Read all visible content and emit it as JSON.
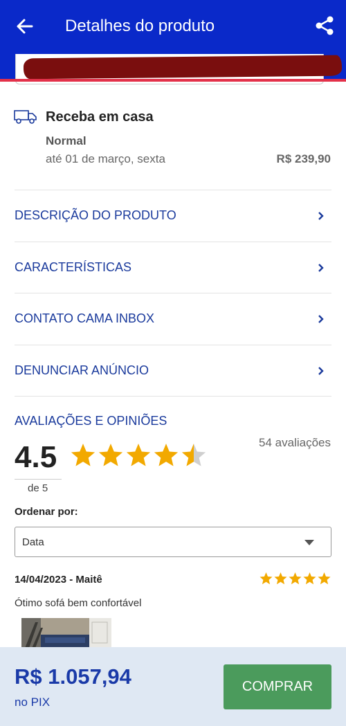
{
  "header": {
    "title": "Detalhes do produto",
    "back_icon": "arrow-left-icon",
    "share_icon": "share-icon",
    "bg_color": "#0a29c9"
  },
  "delivery": {
    "title": "Receba em casa",
    "type": "Normal",
    "date": "até 01 de março, sexta",
    "price": "R$ 239,90"
  },
  "menu": [
    {
      "label": "DESCRIÇÃO DO PRODUTO"
    },
    {
      "label": "CARACTERÍSTICAS"
    },
    {
      "label": "CONTATO CAMA INBOX"
    },
    {
      "label": "DENUNCIAR ANÚNCIO"
    }
  ],
  "reviews": {
    "title": "AVALIAÇÕES E OPINIÕES",
    "rating": "4.5",
    "rating_value": 4.5,
    "rating_of": "de 5",
    "count": "54 avaliações",
    "order_label": "Ordenar por:",
    "order_value": "Data",
    "items": [
      {
        "header": "14/04/2023 - Maitê",
        "stars": 5,
        "text": "Ótimo sofá bem confortável"
      }
    ]
  },
  "bottom": {
    "price": "R$ 1.057,94",
    "price_sub": "no PIX",
    "buy_label": "COMPRAR",
    "buy_color": "#4b9b5c",
    "price_color": "#1a3aa8"
  },
  "colors": {
    "star": "#f2a900",
    "star_empty": "#cfcfcf",
    "link": "#1a3a9c"
  }
}
